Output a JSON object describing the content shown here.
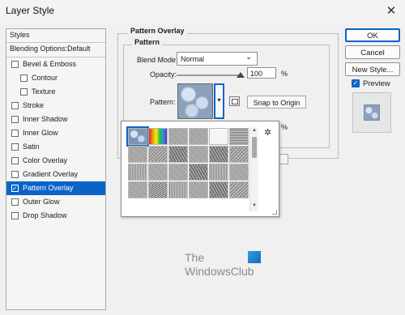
{
  "window": {
    "title": "Layer Style",
    "close_glyph": "✕"
  },
  "styles_panel": {
    "header": "Styles",
    "blending_options": "Blending Options:Default",
    "items": [
      {
        "label": "Bevel & Emboss",
        "checked": false,
        "indent": false
      },
      {
        "label": "Contour",
        "checked": false,
        "indent": true
      },
      {
        "label": "Texture",
        "checked": false,
        "indent": true
      },
      {
        "label": "Stroke",
        "checked": false,
        "indent": false
      },
      {
        "label": "Inner Shadow",
        "checked": false,
        "indent": false
      },
      {
        "label": "Inner Glow",
        "checked": false,
        "indent": false
      },
      {
        "label": "Satin",
        "checked": false,
        "indent": false
      },
      {
        "label": "Color Overlay",
        "checked": false,
        "indent": false
      },
      {
        "label": "Gradient Overlay",
        "checked": false,
        "indent": false
      },
      {
        "label": "Pattern Overlay",
        "checked": true,
        "indent": false,
        "active": true
      },
      {
        "label": "Outer Glow",
        "checked": false,
        "indent": false
      },
      {
        "label": "Drop Shadow",
        "checked": false,
        "indent": false
      }
    ]
  },
  "pattern_overlay": {
    "section_title": "Pattern Overlay",
    "group_title": "Pattern",
    "blend_mode_label": "Blend Mode:",
    "blend_mode_value": "Normal",
    "opacity_label": "Opacity:",
    "opacity_value": "100",
    "opacity_unit": "%",
    "opacity_level": 1.0,
    "pattern_label": "Pattern:",
    "snap_button": "Snap to Origin",
    "pct_fragment": "%"
  },
  "pattern_picker": {
    "gear_icon": "gear-icon",
    "tiles": [
      "blue-bubbles",
      "rainbow",
      "gray-fine",
      "gray-fine",
      "white",
      "gray-wave",
      "gray-fine",
      "gray-grain",
      "gray-coarse",
      "gray-fine",
      "gray-coarse",
      "gray-grain",
      "gray-stripe",
      "gray-fine",
      "gray-fine",
      "gray-coarse",
      "gray-stripe",
      "gray-fine",
      "gray-fine",
      "gray-speckle",
      "gray-stripe",
      "gray-fine",
      "gray-coarse",
      "gray-grain"
    ]
  },
  "actions": {
    "ok": "OK",
    "cancel": "Cancel",
    "new_style": "New Style...",
    "preview_label": "Preview",
    "preview_checked": true
  },
  "watermark": {
    "line1": "The",
    "line2": "WindowsClub"
  },
  "colors": {
    "accent": "#0a64c8",
    "selected_item_text": "#ffffff"
  }
}
